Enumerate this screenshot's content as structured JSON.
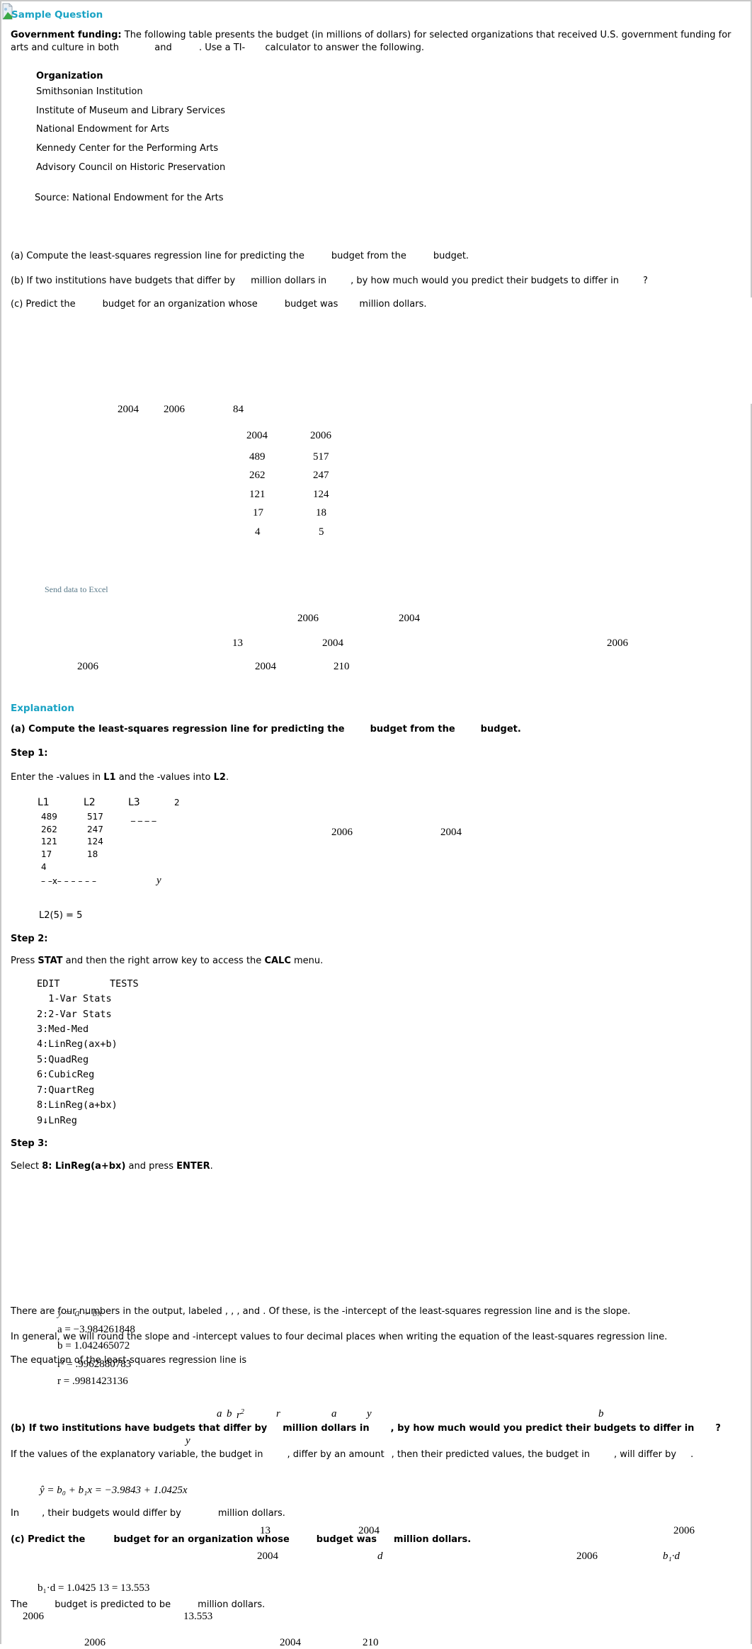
{
  "header": {
    "title": "Sample Question",
    "broken_image_icon": "broken-image-icon"
  },
  "question": {
    "intro_bold": "Government funding:",
    "intro_text_1": "The following table presents the budget (in millions of dollars) for selected organizations that received U.S. government funding for",
    "intro_text_2": "arts and culture in both",
    "intro_and": "and",
    "intro_text_3": ". Use a TI-",
    "intro_text_4": "calculator to answer the following.",
    "table_header": "Organization",
    "organizations": [
      "Smithsonian Institution",
      "Institute of Museum and Library Services",
      "National Endowment for Arts",
      "Kennedy Center for the Performing Arts",
      "Advisory Council on Historic Preservation"
    ],
    "source": "Source: National Endowment for the Arts",
    "part_a": {
      "p1": "(a) Compute the least-squares regression line for predicting the",
      "p2": "budget from the",
      "p3": "budget."
    },
    "part_b": {
      "p1": "(b) If two institutions have budgets that differ by",
      "p2": "million dollars in",
      "p3": ", by how much would you predict their budgets to differ in",
      "p4": "?"
    },
    "part_c": {
      "p1": "(c) Predict the",
      "p2": "budget for an organization whose",
      "p3": "budget was",
      "p4": "million dollars."
    }
  },
  "floating_math": {
    "q_years_row": [
      "2004",
      "2006",
      "84"
    ],
    "table_cols": [
      "2004",
      "2006"
    ],
    "table_rows": [
      [
        "489",
        "517"
      ],
      [
        "262",
        "247"
      ],
      [
        "121",
        "124"
      ],
      [
        "17",
        "18"
      ],
      [
        "4",
        "5"
      ]
    ],
    "q_b_row": [
      "2006",
      "2004"
    ],
    "q_b_row2": [
      "13",
      "2004",
      "2006"
    ],
    "q_c_row": [
      "2006",
      "2004",
      "210"
    ]
  },
  "send_to_excel": "Send data to Excel",
  "explanation": {
    "title": "Explanation",
    "a_heading": {
      "p1": "(a) Compute the least-squares regression line for predicting the",
      "p2": "budget from the",
      "p3": "budget."
    },
    "step1": "Step 1:",
    "step1_text": {
      "p1": "Enter  the  -values  in",
      "L1": "L1",
      "p2": "and  the  -values  into",
      "L2": "L2",
      "p3": "."
    },
    "calc_list": {
      "headers": [
        "L1",
        "L2",
        "L3",
        "2"
      ],
      "L1": [
        "489",
        "262",
        "121",
        "17",
        "4"
      ],
      "L2": [
        "517",
        "247",
        "124",
        "18"
      ],
      "L3_dashes": "_ _ _ _",
      "dash_row": "– –x– –   – – – –",
      "y_label": "y",
      "footer": "L2(5) = 5"
    },
    "step1_overlay": [
      "2006",
      "2004"
    ],
    "step2": "Step 2:",
    "step2_text": {
      "p1": "Press",
      "stat": "STAT",
      "p2": "and then the right arrow key to access the",
      "calc": "CALC",
      "p3": "menu."
    },
    "calc_menu": {
      "tabs": [
        "EDIT",
        "TESTS"
      ],
      "items": [
        "  1-Var Stats",
        "2:2-Var Stats",
        "3:Med-Med",
        "4:LinReg(ax+b)",
        "5:QuadReg",
        "6:CubicReg",
        "7:QuartReg",
        "8:LinReg(a+bx)",
        "9↓LnReg"
      ]
    },
    "step3": "Step 3:",
    "step3_text": {
      "p1": "Select",
      "sel": "8: LinReg(a+bx)",
      "p2": "and press",
      "enter": "ENTER",
      "p3": "."
    },
    "output_text_1": "There are four numbers in the output, labeled , ,   , and . Of these, is the -intercept of the least-squares regression line and is the slope.",
    "output_text_2": "In general, we will round the slope and  -intercept values to four decimal places when writing the equation of the least-squares regression line.",
    "output_text_3": "The equation of the least-squares regression line is",
    "output_values": {
      "eq": "y = a + bx",
      "a": "a = −3.984261848",
      "b": "b = 1.042465072",
      "r2": "r² = .9962880783",
      "r": "r = .9981423136"
    },
    "labels_row": {
      "a": "a",
      "b": "b",
      "r2": "r",
      "r": "r",
      "a2": "a",
      "y": "y",
      "b2": "b"
    },
    "b_heading": {
      "p1": "(b) If two institutions have budgets that differ by",
      "p2": "million dollars in",
      "p3": ", by how much would you predict their budgets to differ in",
      "p4": "?"
    },
    "b_y": "y",
    "b_text": {
      "p1": "If the values of the explanatory variable, the budget in",
      "p2": ", differ by an amount",
      "p3": ", then their predicted values, the budget in",
      "p4": ", will differ by",
      "p5": "."
    },
    "regression_eq": "ŷ = b₀ + b₁x = −3.9843 + 1.0425x",
    "in_text": {
      "p1": "In",
      "p2": ", their budgets would differ by",
      "p3": "million dollars."
    },
    "overlay_13": "13",
    "overlay_2004": "2004",
    "overlay_2006": "2006",
    "c_heading": {
      "p1": "(c) Predict the",
      "p2": "budget for an organization whose",
      "p3": "budget was",
      "p4": "million dollars."
    },
    "c_row": {
      "y2004": "2004",
      "d": "d",
      "y2006": "2006",
      "b1d": "b₁·d"
    },
    "b1d_calc": "b₁·d = 1.0425  13  = 13.553",
    "the_text": {
      "p1": "The",
      "p2": "budget is predicted to be",
      "p3": "million dollars."
    },
    "the_row": {
      "y2006": "2006",
      "val": "13.553"
    },
    "bottom_row": [
      "2006",
      "2004",
      "210"
    ]
  }
}
